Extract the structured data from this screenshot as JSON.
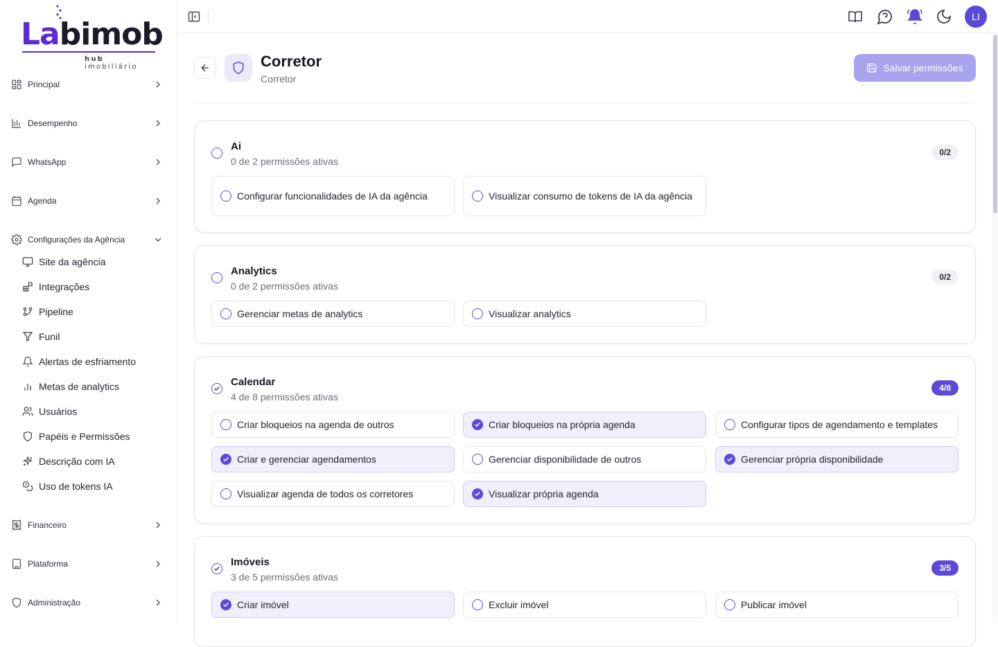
{
  "brand": {
    "logo_main": "Labimob",
    "logo_sub_bold": "hub",
    "logo_sub_rest": "imobiliário",
    "accent_color": "#5b4ad8"
  },
  "sidebar": {
    "groups": [
      {
        "label": "Principal",
        "icon": "grid-icon"
      },
      {
        "label": "Desempenho",
        "icon": "bar-chart-icon"
      },
      {
        "label": "WhatsApp",
        "icon": "chat-icon"
      },
      {
        "label": "Agenda",
        "icon": "calendar-icon"
      },
      {
        "label": "Configurações da Agência",
        "icon": "gear-icon",
        "expanded": true
      },
      {
        "label": "Financeiro",
        "icon": "receipt-icon"
      },
      {
        "label": "Plataforma",
        "icon": "building-icon"
      },
      {
        "label": "Administração",
        "icon": "shield-icon"
      }
    ],
    "sub_items": [
      {
        "label": "Site da agência",
        "icon": "monitor-icon"
      },
      {
        "label": "Integrações",
        "icon": "blocks-icon"
      },
      {
        "label": "Pipeline",
        "icon": "git-branch-icon"
      },
      {
        "label": "Funil",
        "icon": "funnel-icon"
      },
      {
        "label": "Alertas de esfriamento",
        "icon": "bell-icon"
      },
      {
        "label": "Metas de analytics",
        "icon": "bar-chart-icon"
      },
      {
        "label": "Usuários",
        "icon": "users-icon"
      },
      {
        "label": "Papéis e Permissões",
        "icon": "shield-icon"
      },
      {
        "label": "Descrição com IA",
        "icon": "sparkles-icon"
      },
      {
        "label": "Uso de tokens IA",
        "icon": "coins-icon"
      }
    ]
  },
  "topbar": {
    "avatar_initials": "LI",
    "icons": [
      "book-icon",
      "help-chat-icon",
      "bell-ring-icon",
      "moon-icon"
    ]
  },
  "header": {
    "title": "Corretor",
    "subtitle": "Corretor",
    "save_label": "Salvar permissões"
  },
  "sections": [
    {
      "title": "Ai",
      "summary": "0 de 2 permissões ativas",
      "badge": "0/2",
      "active": false,
      "permissions": [
        {
          "label": "Configurar funcionalidades de IA da agência",
          "on": false
        },
        {
          "label": "Visualizar consumo de tokens de IA da agência",
          "on": false
        }
      ]
    },
    {
      "title": "Analytics",
      "summary": "0 de 2 permissões ativas",
      "badge": "0/2",
      "active": false,
      "permissions": [
        {
          "label": "Gerenciar metas de analytics",
          "on": false
        },
        {
          "label": "Visualizar analytics",
          "on": false
        }
      ]
    },
    {
      "title": "Calendar",
      "summary": "4 de 8 permissões ativas",
      "badge": "4/8",
      "active": true,
      "permissions": [
        {
          "label": "Criar bloqueios na agenda de outros",
          "on": false
        },
        {
          "label": "Criar bloqueios na própria agenda",
          "on": true
        },
        {
          "label": "Configurar tipos de agendamento e templates",
          "on": false
        },
        {
          "label": "Criar e gerenciar agendamentos",
          "on": true
        },
        {
          "label": "Gerenciar disponibilidade de outros",
          "on": false
        },
        {
          "label": "Gerenciar própria disponibilidade",
          "on": true
        },
        {
          "label": "Visualizar agenda de todos os corretores",
          "on": false
        },
        {
          "label": "Visualizar própria agenda",
          "on": true
        }
      ]
    },
    {
      "title": "Imóveis",
      "summary": "3 de 5 permissões ativas",
      "badge": "3/5",
      "active": true,
      "permissions": [
        {
          "label": "Criar imóvel",
          "on": true
        },
        {
          "label": "Excluir imóvel",
          "on": false
        },
        {
          "label": "Publicar imóvel",
          "on": false
        }
      ]
    }
  ]
}
